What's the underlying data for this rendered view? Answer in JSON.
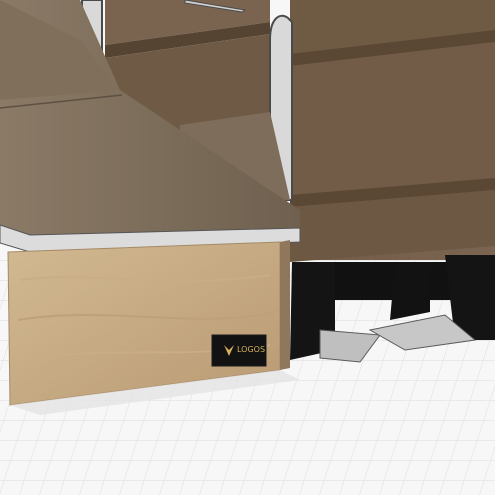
{
  "scene": {
    "description_free": true,
    "logo_text": "LOGOS",
    "colors": {
      "grid_bg": "#f7f7f7",
      "grid_line": "#dcdcdc",
      "tabletop": "#7a6a57",
      "tabletop_light": "#8a7a66",
      "panel_front": "#c2a77f",
      "drawer": "#6f5a44",
      "drawer_dark": "#5b4836",
      "metal": "#d9d9d9",
      "black": "#121212",
      "logo_gold": "#d6b25a"
    }
  }
}
